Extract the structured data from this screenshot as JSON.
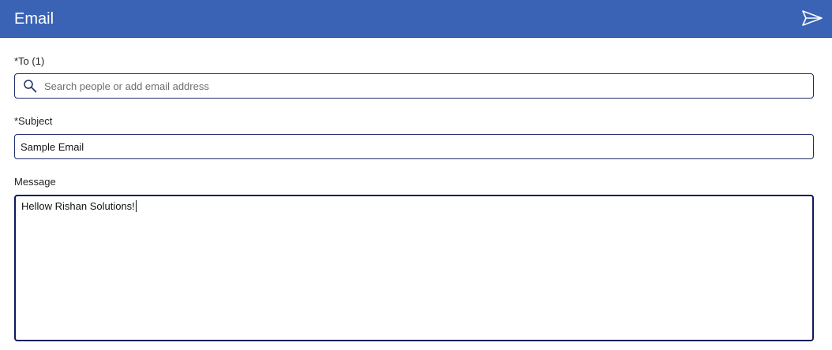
{
  "header": {
    "title": "Email",
    "send_icon": "send-icon"
  },
  "to_field": {
    "label": "*To (1)",
    "placeholder": "Search people or add email address",
    "value": "",
    "icon": "search-icon"
  },
  "subject_field": {
    "label": "*Subject",
    "value": "Sample Email"
  },
  "message_field": {
    "label": "Message",
    "value": "Hellow Rishan Solutions!"
  },
  "colors": {
    "header_bg": "#3a63b5",
    "border": "#1f2d6b",
    "focus_border": "#0c1a5c"
  }
}
